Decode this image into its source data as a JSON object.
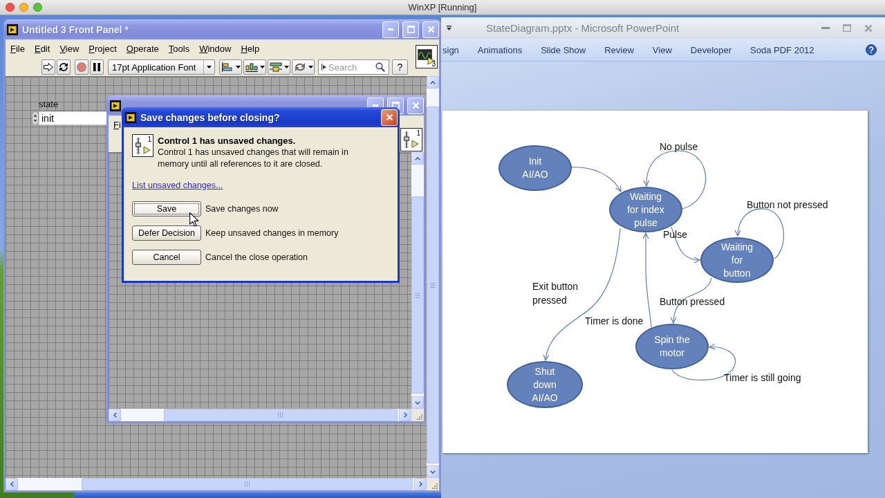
{
  "vm_window": {
    "title": "WinXP [Running]"
  },
  "powerpoint": {
    "title": "StateDiagram.pptx - Microsoft PowerPoint",
    "ribbon_tabs": [
      "sign",
      "Animations",
      "Slide Show",
      "Review",
      "View",
      "Developer",
      "Soda PDF 2012"
    ],
    "slide": {
      "states": [
        {
          "lines": [
            "Init",
            "AI/AO"
          ]
        },
        {
          "lines": [
            "Waiting",
            "for index",
            "pulse"
          ]
        },
        {
          "lines": [
            "Waiting",
            "for",
            "button"
          ]
        },
        {
          "lines": [
            "Spin the",
            "motor"
          ]
        },
        {
          "lines": [
            "Shut",
            "down",
            "AI/AO"
          ]
        }
      ],
      "transition_labels": [
        {
          "lines": [
            "No pulse"
          ]
        },
        {
          "lines": [
            "Button not pressed"
          ]
        },
        {
          "lines": [
            "Pulse"
          ]
        },
        {
          "lines": [
            "Exit button",
            "pressed"
          ]
        },
        {
          "lines": [
            "Button pressed"
          ]
        },
        {
          "lines": [
            "Timer is done"
          ]
        },
        {
          "lines": [
            "Timer is still going"
          ]
        }
      ]
    }
  },
  "front_panel": {
    "title": "Untitled 3 Front Panel *",
    "menu": [
      "File",
      "Edit",
      "View",
      "Project",
      "Operate",
      "Tools",
      "Window",
      "Help"
    ],
    "toolbar": {
      "font": "17pt Application Font",
      "search": {
        "placeholder": "Search"
      },
      "help": "?"
    },
    "icon_number": "3",
    "controls": [
      {
        "kind": "enum",
        "label": "state",
        "value": "init"
      }
    ]
  },
  "control_window": {
    "menu": [
      "Fi"
    ],
    "icon_number": "1"
  },
  "dialog": {
    "title": "Save changes before closing?",
    "icon_number": "1",
    "heading": "Control 1 has unsaved changes.",
    "message": "Control 1 has unsaved changes that will remain in memory until all references to it are closed.",
    "link": "List unsaved changes...",
    "actions": [
      {
        "button": "Save",
        "description": "Save changes now",
        "focused": true
      },
      {
        "button": "Defer Decision",
        "description": "Keep unsaved changes in memory",
        "focused": false
      },
      {
        "button": "Cancel",
        "description": "Cancel the close operation",
        "focused": false
      }
    ]
  }
}
